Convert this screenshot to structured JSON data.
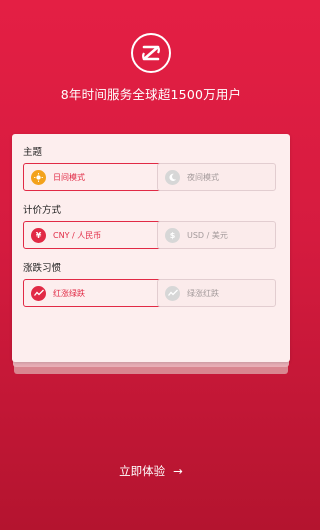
{
  "header": {
    "logo_icon": "zb-logo-icon",
    "tagline": "8年时间服务全球超1500万用户"
  },
  "settings": {
    "theme": {
      "label": "主题",
      "options": [
        {
          "label": "日间模式",
          "icon": "sun-icon",
          "selected": true
        },
        {
          "label": "夜间模式",
          "icon": "moon-icon",
          "selected": false
        }
      ]
    },
    "pricing": {
      "label": "计价方式",
      "options": [
        {
          "label": "CNY / 人民币",
          "icon": "yen-icon",
          "glyph": "¥",
          "selected": true
        },
        {
          "label": "USD / 美元",
          "icon": "dollar-icon",
          "glyph": "$",
          "selected": false
        }
      ]
    },
    "trend": {
      "label": "涨跌习惯",
      "options": [
        {
          "label": "红涨绿跌",
          "icon": "trend-red-up-icon",
          "selected": true
        },
        {
          "label": "绿涨红跌",
          "icon": "trend-green-up-icon",
          "selected": false
        }
      ]
    }
  },
  "cta": {
    "label": "立即体验",
    "arrow": "→"
  },
  "colors": {
    "accent": "#e12a45",
    "background_top": "#e41f44",
    "background_bottom": "#b4142f",
    "card": "#fdeeee",
    "sun": "#f3a21c"
  }
}
